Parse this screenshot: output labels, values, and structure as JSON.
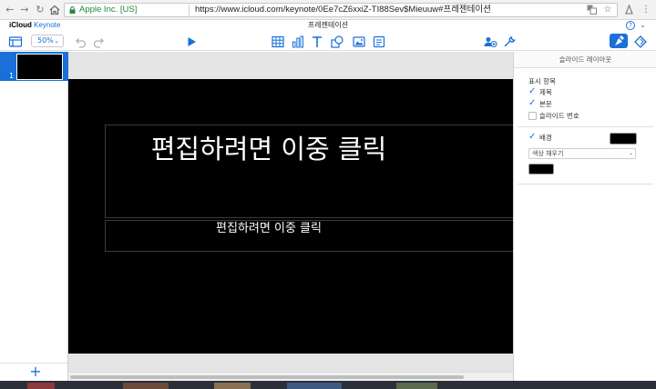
{
  "browser": {
    "secure_label": "Apple Inc. [US]",
    "url": "https://www.icloud.com/keynote/0Ee7cZ6xxiZ-TI88Sev$Mieuuw#프레젠테이션"
  },
  "app": {
    "brand_icloud": "iCloud",
    "brand_keynote": "Keynote",
    "document_title": "프레젠테이션",
    "help_label": "?"
  },
  "toolbar": {
    "zoom_value": "50%",
    "icons": [
      "slide-view-icon",
      "undo-icon",
      "redo-icon",
      "play-icon",
      "table-icon",
      "chart-icon",
      "text-icon",
      "shape-icon",
      "media-icon",
      "comment-icon",
      "collaborate-icon",
      "tools-icon",
      "format-brush-icon",
      "animate-icon"
    ]
  },
  "navigator": {
    "slides": [
      {
        "number": "1"
      }
    ],
    "add_label": "+"
  },
  "slide": {
    "title": "편집하려면 이중 클릭",
    "body": "편집하려면 이중 클릭",
    "background_color": "#000000"
  },
  "inspector": {
    "tab_title": "슬라이드 레이아웃",
    "show_label": "표시 항목",
    "options": [
      {
        "label": "제목",
        "checked": true
      },
      {
        "label": "본문",
        "checked": true
      },
      {
        "label": "슬라이드 번호",
        "checked": false
      }
    ],
    "background": {
      "label": "배경",
      "checked": true,
      "color": "#000000"
    },
    "fill_type": "색상 채우기",
    "fill_color": "#000000"
  },
  "colors": {
    "accent": "#1a6fd9",
    "secure_green": "#1f8a3a"
  }
}
